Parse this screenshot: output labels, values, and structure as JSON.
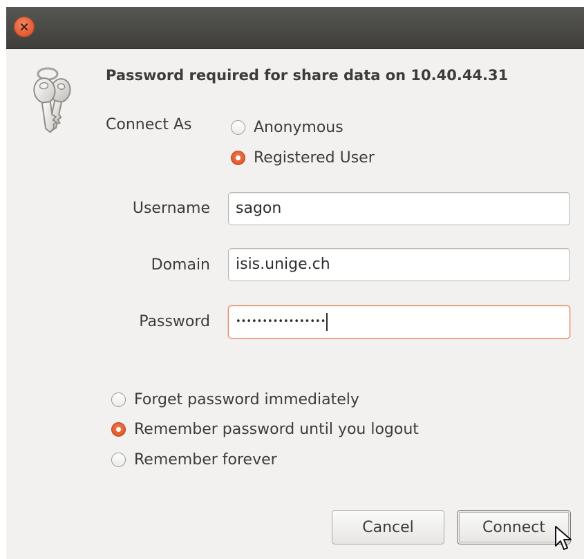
{
  "dialog": {
    "heading": "Password required for share data on 10.40.44.31",
    "connect_as": {
      "label": "Connect As",
      "options": [
        {
          "label": "Anonymous",
          "checked": false
        },
        {
          "label": "Registered User",
          "checked": true
        }
      ]
    },
    "fields": {
      "username": {
        "label": "Username",
        "value": "sagon"
      },
      "domain": {
        "label": "Domain",
        "value": "isis.unige.ch"
      },
      "password": {
        "label": "Password",
        "value": "•••••••••••••••••"
      }
    },
    "remember": {
      "options": [
        {
          "label": "Forget password immediately",
          "checked": false
        },
        {
          "label": "Remember password until you logout",
          "checked": true
        },
        {
          "label": "Remember forever",
          "checked": false
        }
      ]
    },
    "buttons": {
      "cancel": "Cancel",
      "connect": "Connect"
    }
  },
  "colors": {
    "accent": "#e05a2b",
    "titlebar": "#4a4945",
    "background": "#f2f1f0",
    "focus_border": "#ec8a65"
  },
  "icons": {
    "close": "close-icon",
    "keys": "keys-icon",
    "pointer": "mouse-pointer-icon"
  }
}
